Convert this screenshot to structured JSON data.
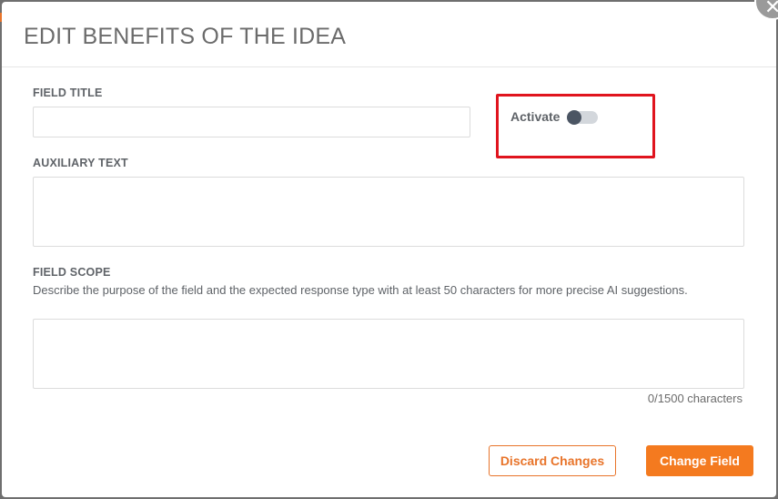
{
  "modal": {
    "title": "EDIT BENEFITS OF THE IDEA",
    "close_icon": "close-icon"
  },
  "form": {
    "field_title": {
      "label": "FIELD TITLE",
      "value": "",
      "placeholder": ""
    },
    "activate": {
      "label": "Activate",
      "enabled": false
    },
    "auxiliary_text": {
      "label": "AUXILIARY TEXT",
      "value": "",
      "placeholder": ""
    },
    "field_scope": {
      "label": "FIELD SCOPE",
      "description": "Describe the purpose of the field and the expected response type with at least 50 characters for more precise AI suggestions.",
      "value": "",
      "placeholder": "",
      "counter": "0/1500 characters"
    }
  },
  "actions": {
    "discard_label": "Discard Changes",
    "change_label": "Change Field"
  },
  "colors": {
    "accent": "#f47a1f",
    "highlight": "#e0141e",
    "toggle_off_track": "#d3d7dc",
    "toggle_knob": "#4b5563"
  }
}
